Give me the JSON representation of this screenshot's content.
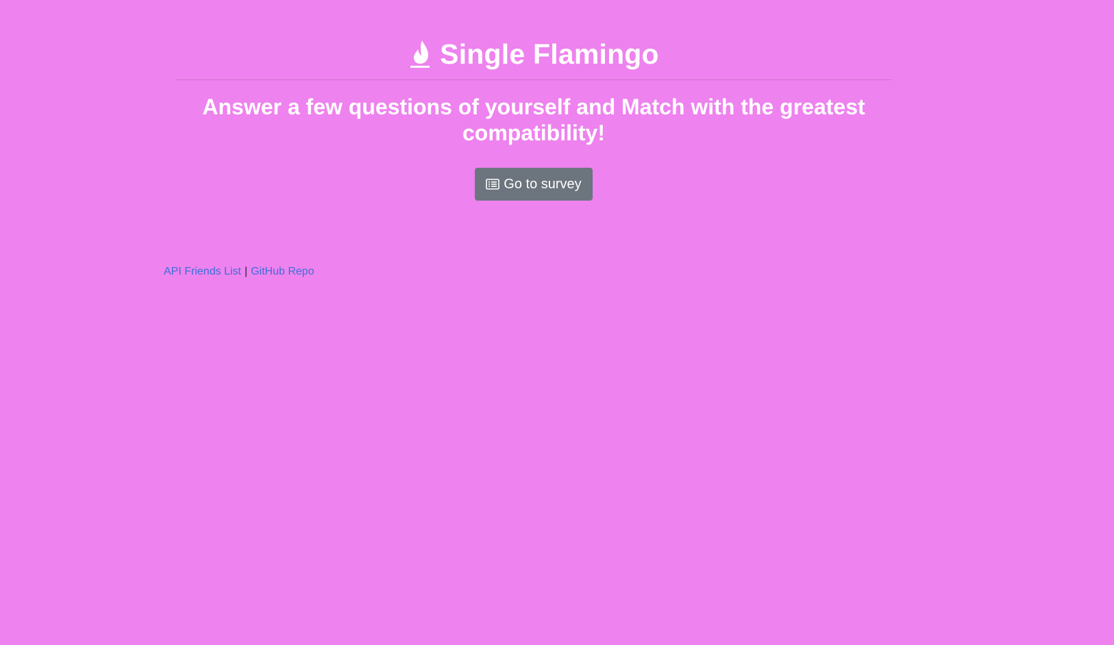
{
  "header": {
    "title": "Single Flamingo",
    "icon": "fire-icon"
  },
  "main": {
    "tagline": "Answer a few questions of yourself and Match with the greatest compatibility!",
    "survey_button": {
      "label": "Go to survey",
      "icon": "list-alt-icon"
    }
  },
  "footer": {
    "links": [
      {
        "label": "API Friends List"
      },
      {
        "label": "GitHub Repo"
      }
    ],
    "separator": "|"
  },
  "colors": {
    "background": "#ee82ee",
    "button": "#6c757d",
    "link": "#3b6fd9"
  }
}
